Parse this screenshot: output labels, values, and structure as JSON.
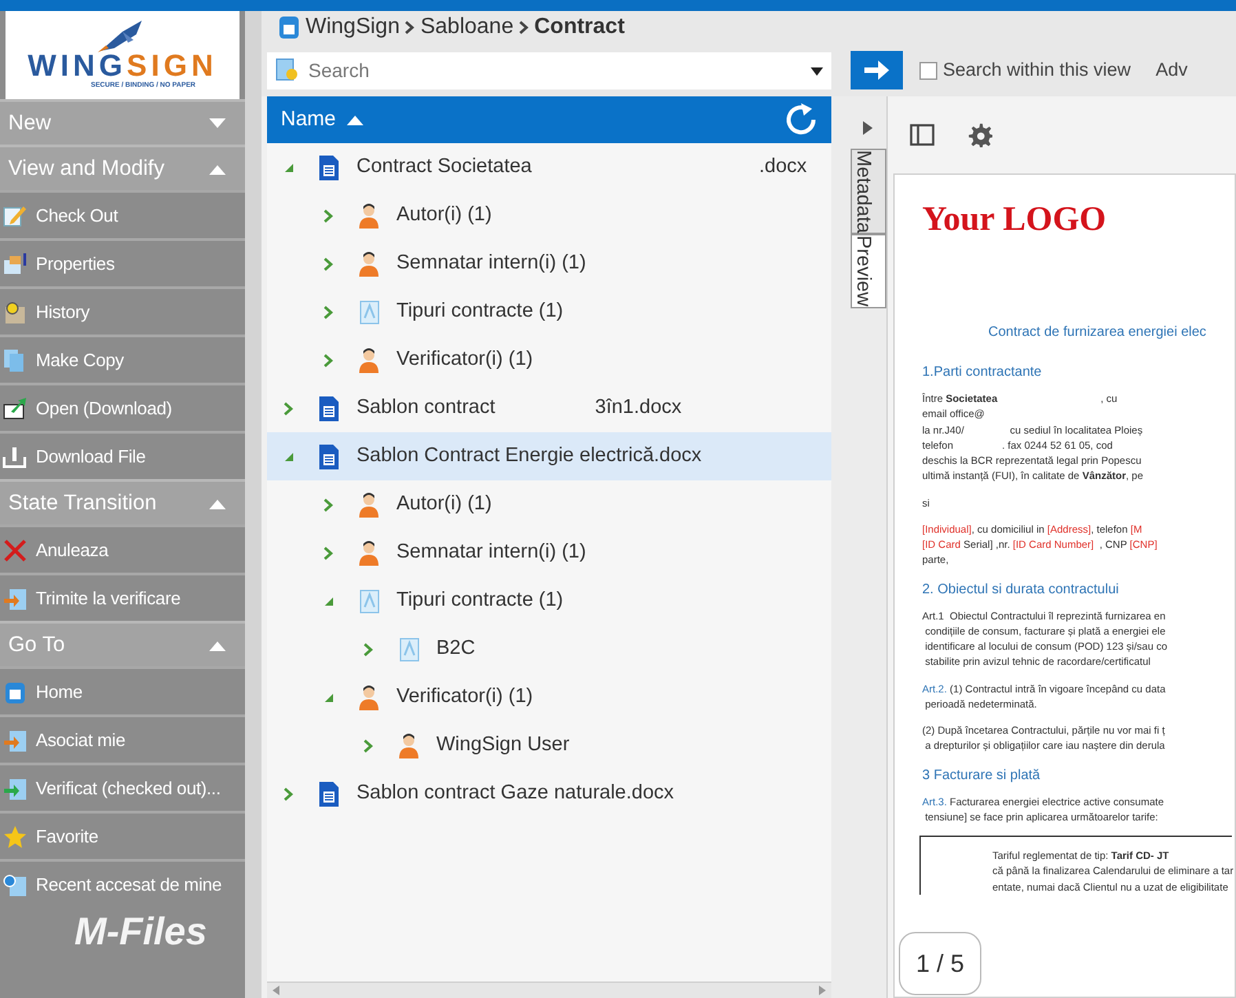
{
  "logo": {
    "first": "WING",
    "second": "SIGN",
    "tagline": "SECURE / BINDING / NO PAPER"
  },
  "sidebar": {
    "sections": [
      {
        "title": "New",
        "expanded": false
      },
      {
        "title": "View and Modify",
        "expanded": true,
        "items": [
          {
            "label": "Check Out",
            "kind": "edit"
          },
          {
            "label": "Properties",
            "kind": "properties"
          },
          {
            "label": "History",
            "kind": "history"
          },
          {
            "label": "Make Copy",
            "kind": "copy"
          },
          {
            "label": "Open (Download)",
            "kind": "open"
          },
          {
            "label": "Download File",
            "kind": "download"
          }
        ]
      },
      {
        "title": "State Transition",
        "expanded": true,
        "items": [
          {
            "label": "Anuleaza",
            "kind": "cancel"
          },
          {
            "label": "Trimite la verificare",
            "kind": "send"
          }
        ]
      },
      {
        "title": "Go To",
        "expanded": true,
        "items": [
          {
            "label": "Home",
            "kind": "home"
          },
          {
            "label": "Asociat mie",
            "kind": "send"
          },
          {
            "label": "Verificat (checked out)...",
            "kind": "checkin"
          },
          {
            "label": "Favorite",
            "kind": "star"
          },
          {
            "label": "Recent accesat de mine",
            "kind": "recent"
          }
        ]
      }
    ],
    "footer": "M-Files"
  },
  "breadcrumb": [
    {
      "label": "WingSign",
      "current": false
    },
    {
      "label": "Sabloane",
      "current": false
    },
    {
      "label": "Contract",
      "current": true
    }
  ],
  "search": {
    "placeholder": "Search",
    "within_view": {
      "label": "Search within this view",
      "checked": false
    },
    "advanced": "Adv"
  },
  "list": {
    "column": "Name",
    "tree": [
      {
        "label": "Contract Societatea                                         .docx",
        "kind": "document",
        "expanded": true,
        "selected": false,
        "children": [
          {
            "label": "Autor(i) (1)",
            "kind": "person",
            "expanded": false,
            "selected": false
          },
          {
            "label": "Semnatar intern(i) (1)",
            "kind": "person",
            "expanded": false,
            "selected": false
          },
          {
            "label": "Tipuri contracte (1)",
            "kind": "class",
            "expanded": false,
            "selected": false
          },
          {
            "label": "Verificator(i) (1)",
            "kind": "person",
            "expanded": false,
            "selected": false
          }
        ]
      },
      {
        "label": "Sablon contract                  3în1.docx",
        "kind": "document",
        "expanded": false,
        "selected": false
      },
      {
        "label": "Sablon Contract Energie electrică.docx",
        "kind": "document",
        "expanded": true,
        "selected": true,
        "children": [
          {
            "label": "Autor(i) (1)",
            "kind": "person",
            "expanded": false,
            "selected": false
          },
          {
            "label": "Semnatar intern(i) (1)",
            "kind": "person",
            "expanded": false,
            "selected": false
          },
          {
            "label": "Tipuri contracte (1)",
            "kind": "class",
            "expanded": true,
            "selected": false,
            "children": [
              {
                "label": "B2C",
                "kind": "class",
                "expanded": false,
                "selected": false
              }
            ]
          },
          {
            "label": "Verificator(i) (1)",
            "kind": "person",
            "expanded": true,
            "selected": false,
            "children": [
              {
                "label": "WingSign User",
                "kind": "person",
                "expanded": false,
                "selected": false
              }
            ]
          }
        ]
      },
      {
        "label": "Sablon contract Gaze naturale.docx",
        "kind": "document",
        "expanded": false,
        "selected": false
      }
    ]
  },
  "side_tabs": [
    {
      "label": "Metadata",
      "selected": false
    },
    {
      "label": "Preview",
      "selected": true
    }
  ],
  "preview": {
    "page_indicator": "1 / 5",
    "blocks": [
      {
        "kind": "logo",
        "lines": [
          "Your LOGO"
        ]
      },
      {
        "kind": "title",
        "lines": [
          "Contract de furnizarea energiei elec"
        ]
      },
      {
        "kind": "heading",
        "lines": [
          "1.Parti contractante"
        ]
      },
      {
        "kind": "para",
        "lines": [
          "Între **Societatea**                                    , cu",
          "email office@",
          "la nr.J40/                cu sediul în localitatea Ploieș",
          "telefon                 . fax 0244 52 61 05, cod",
          "deschis la BCR reprezentată legal prin Popescu",
          "ultimă instanță (FUI), în calitate de **Vânzător**, pe"
        ]
      },
      {
        "kind": "para",
        "lines": [
          "si"
        ]
      },
      {
        "kind": "para",
        "lines": [
          [
            {
              "text": "[Individual]",
              "kind": "red"
            },
            {
              "text": ", cu domiciliul in ",
              "kind": "plain"
            },
            {
              "text": "[Address]",
              "kind": "red"
            },
            {
              "text": ", telefon ",
              "kind": "plain"
            },
            {
              "text": "[M",
              "kind": "red"
            }
          ],
          [
            {
              "text": "[ID Card",
              "kind": "red"
            },
            {
              "text": " Serial] ,nr. ",
              "kind": "plain"
            },
            {
              "text": "[ID Card Number]",
              "kind": "red"
            },
            {
              "text": "  , CNP ",
              "kind": "plain"
            },
            {
              "text": "[CNP]",
              "kind": "red"
            }
          ],
          "parte,"
        ]
      },
      {
        "kind": "heading",
        "lines": [
          "2. Obiectul si durata contractului"
        ]
      },
      {
        "kind": "para",
        "lines": [
          "Art.1  Obiectul Contractului îl reprezintă furnizarea en",
          " condițiile de consum, facturare și plată a energiei ele",
          " identificare al locului de consum (POD) 123 și/sau co",
          " stabilite prin avizul tehnic de racordare/certificatul"
        ]
      },
      {
        "kind": "para",
        "lines": [
          [
            {
              "text": "Art.2.",
              "kind": "blue"
            },
            {
              "text": " (1) Contractul intră în vigoare începând cu data",
              "kind": "plain"
            }
          ],
          " perioadă nedeterminată."
        ]
      },
      {
        "kind": "para",
        "lines": [
          "(2) După încetarea Contractului, părțile nu vor mai fi ț",
          " a drepturilor și obligațiilor care iau naștere din derula"
        ]
      },
      {
        "kind": "heading",
        "lines": [
          "3 Facturare si plată"
        ]
      },
      {
        "kind": "para",
        "lines": [
          [
            {
              "text": "Art.3.",
              "kind": "blue"
            },
            {
              "text": " Facturarea energiei electrice active consumate",
              "kind": "plain"
            }
          ],
          " tensiune] se face prin aplicarea următoarelor tarife:"
        ]
      },
      {
        "kind": "table",
        "lines": [
          "Tariful reglementat de tip: **Tarif CD- JT**",
          "că până la finalizarea Calendarului de eliminare a tar",
          "entate, numai dacă Clientul nu a uzat de eligibilitate"
        ]
      }
    ]
  }
}
